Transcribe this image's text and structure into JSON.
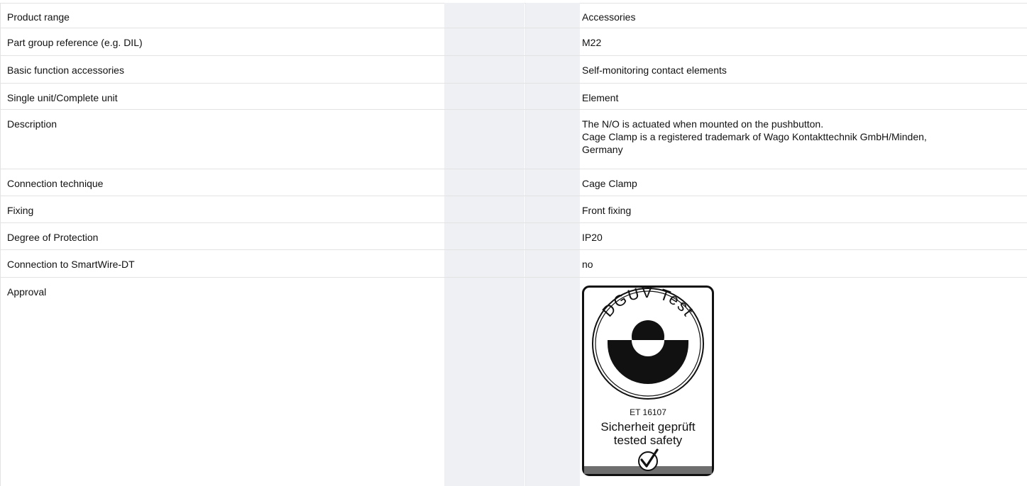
{
  "rows": [
    {
      "label": "Product range",
      "value": "Accessories"
    },
    {
      "label": "Part group reference (e.g. DIL)",
      "value": "M22"
    },
    {
      "label": "Basic function accessories",
      "value": "Self-monitoring contact elements"
    },
    {
      "label": "Single unit/Complete unit",
      "value": "Element"
    },
    {
      "label": "Description",
      "value_lines": [
        "The N/O is actuated when mounted on the pushbutton.",
        "Cage Clamp is a registered trademark of Wago Kontakttechnik GmbH/Minden,",
        "Germany"
      ]
    },
    {
      "label": "Connection technique",
      "value": "Cage Clamp"
    },
    {
      "label": "Fixing",
      "value": "Front fixing"
    },
    {
      "label": "Degree of Protection",
      "value": "IP20"
    },
    {
      "label": "Connection to SmartWire-DT",
      "value": "no"
    },
    {
      "label": "Approval"
    }
  ],
  "approval_badge": {
    "ring_text": "DGUV Test",
    "code": "ET 16107",
    "line1": "Sicherheit geprüft",
    "line2": "tested safety"
  }
}
